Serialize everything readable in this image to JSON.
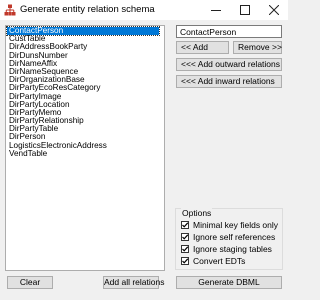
{
  "window": {
    "title": "Generate entity relation schema",
    "icon": "hierarchy-icon",
    "controls": {
      "minimize": "—",
      "maximize": "☐",
      "close": "✕"
    }
  },
  "entity_list": {
    "selected_index": 0,
    "items": [
      "ContactPerson",
      "CustTable",
      "DirAddressBookParty",
      "DirDunsNumber",
      "DirNameAffix",
      "DirNameSequence",
      "DirOrganizationBase",
      "DirPartyEcoResCategory",
      "DirPartyImage",
      "DirPartyLocation",
      "DirPartyMemo",
      "DirPartyRelationship",
      "DirPartyTable",
      "DirPerson",
      "LogisticsElectronicAddress",
      "VendTable"
    ]
  },
  "entity_input": {
    "value": "ContactPerson"
  },
  "buttons": {
    "add": "<< Add",
    "remove": "Remove >>",
    "add_outward": "<<< Add outward relations",
    "add_inward": "<<< Add inward relations",
    "clear": "Clear",
    "add_all": "Add all relations",
    "generate": "Generate DBML"
  },
  "options": {
    "legend": "Options",
    "items": [
      {
        "label": "Minimal key fields only",
        "checked": true
      },
      {
        "label": "Ignore self references",
        "checked": true
      },
      {
        "label": "Ignore staging tables",
        "checked": true
      },
      {
        "label": "Convert EDTs",
        "checked": true
      }
    ]
  }
}
